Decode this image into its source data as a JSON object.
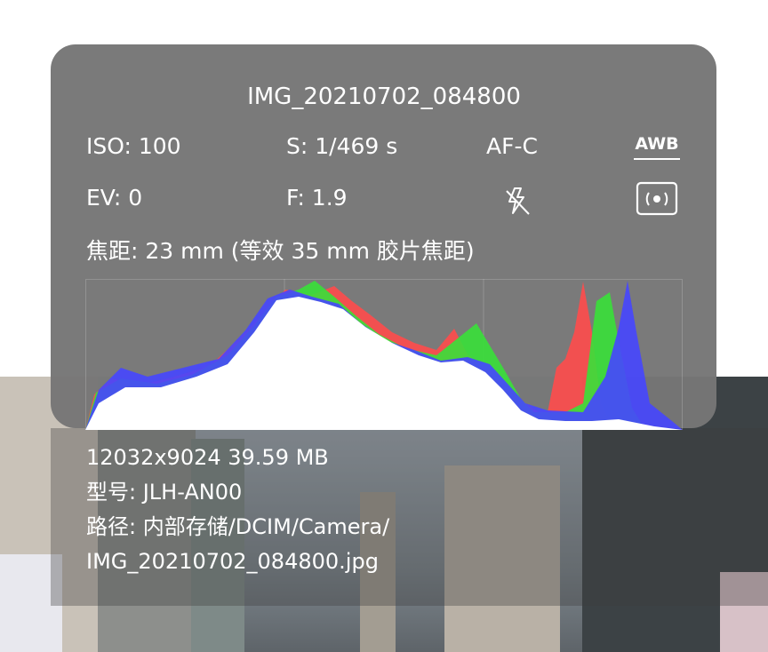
{
  "file": {
    "name": "IMG_20210702_084800"
  },
  "exif": {
    "iso": "ISO: 100",
    "shutter": "S: 1/469 s",
    "focus_mode": "AF-C",
    "white_balance": "AWB",
    "ev": "EV: 0",
    "aperture": "F: 1.9",
    "flash_icon": "flash-off-icon",
    "metering_icon": "center-metering-icon",
    "focal_length": "焦距: 23 mm (等效 35 mm 胶片焦距)"
  },
  "details": {
    "resolution_size": "12032x9024  39.59 MB",
    "model": "型号:  JLH-AN00",
    "path_line1": "路径:  内部存储/DCIM/Camera/",
    "path_line2": "IMG_20210702_084800.jpg"
  },
  "colors": {
    "panel": "#767676",
    "red": "#ff4b4b",
    "green": "#39e039",
    "blue": "#4646ff",
    "yellow": "#ffff3c",
    "cyan": "#3ce8ff",
    "magenta": "#ff50ff"
  }
}
